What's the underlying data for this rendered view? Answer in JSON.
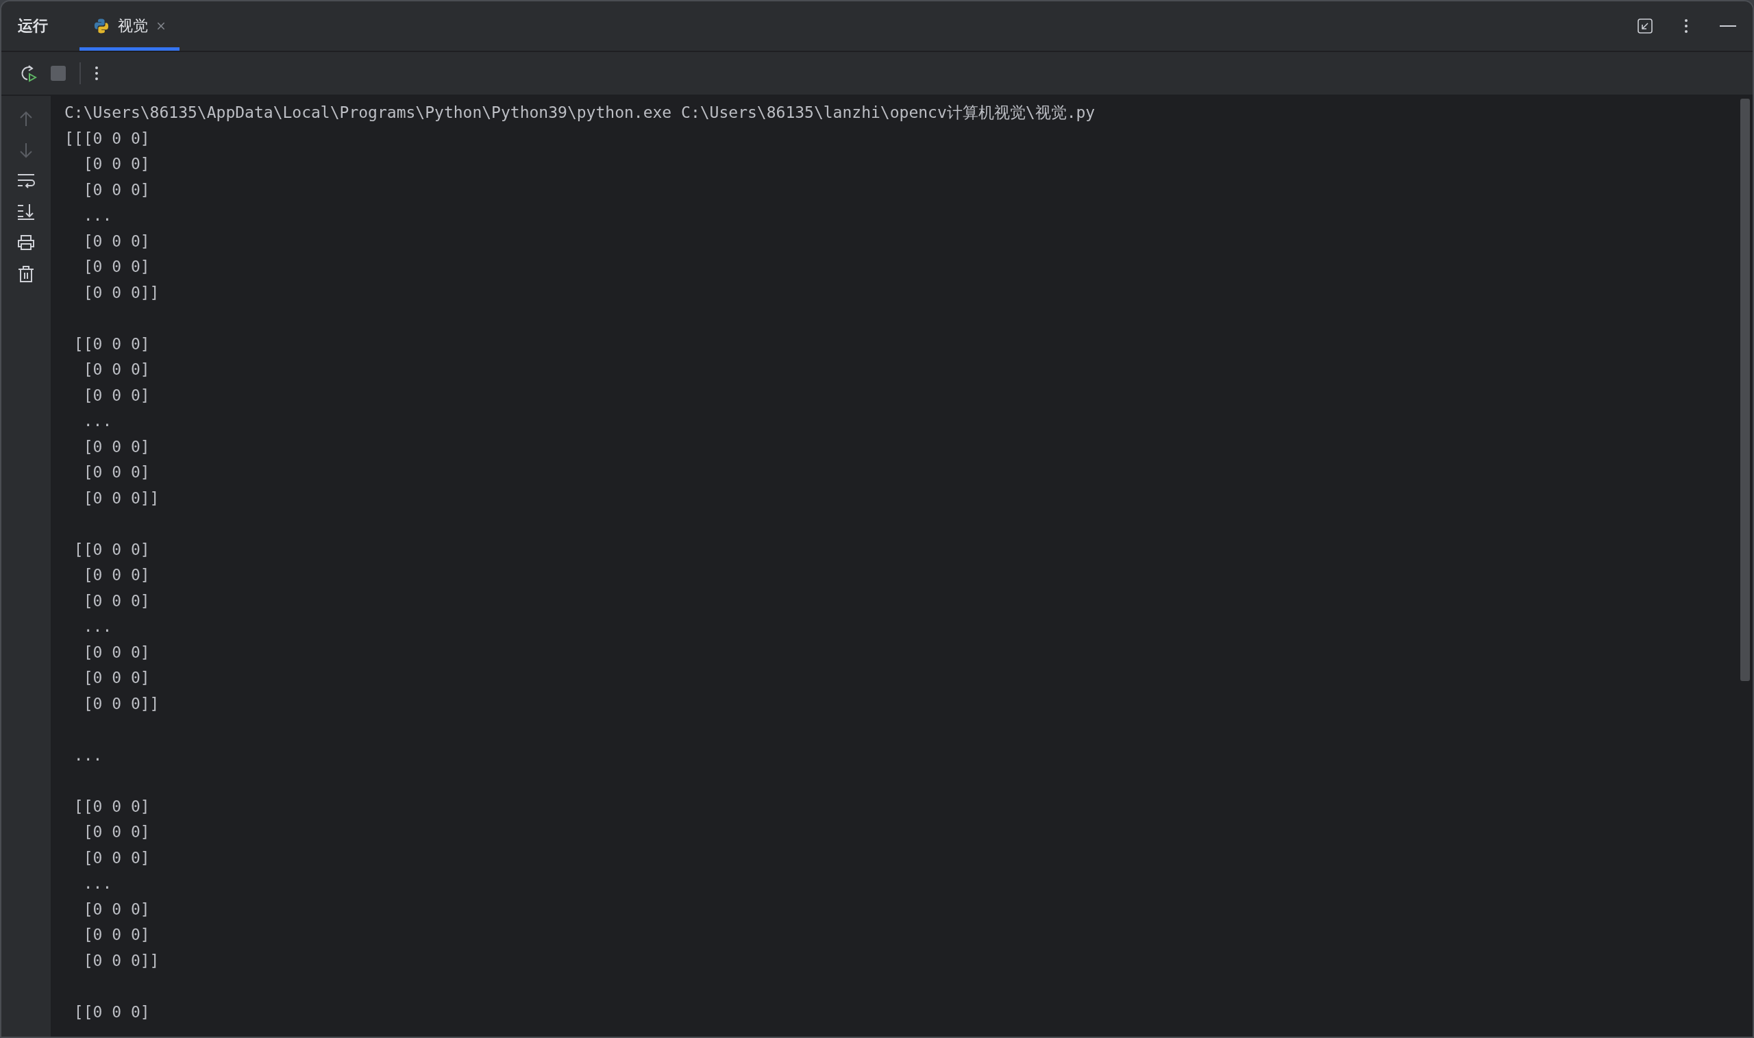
{
  "panel": {
    "title": "运行"
  },
  "tabs": [
    {
      "label": "视觉",
      "selected": true
    }
  ],
  "left_toolbar": [
    {
      "kind": "up",
      "disabled": true
    },
    {
      "kind": "down",
      "disabled": true
    },
    {
      "kind": "wrap",
      "disabled": false
    },
    {
      "kind": "scroll_end",
      "disabled": false
    },
    {
      "kind": "print",
      "disabled": false
    },
    {
      "kind": "delete",
      "disabled": false
    }
  ],
  "output_blocks": [
    [
      "C:\\Users\\86135\\AppData\\Local\\Programs\\Python\\Python39\\python.exe C:\\Users\\86135\\lanzhi\\opencv计算机视觉\\视觉.py",
      "[[[0 0 0]",
      "  [0 0 0]",
      "  [0 0 0]",
      "  ...",
      "  [0 0 0]",
      "  [0 0 0]",
      "  [0 0 0]]"
    ],
    [
      " [[0 0 0]",
      "  [0 0 0]",
      "  [0 0 0]",
      "  ...",
      "  [0 0 0]",
      "  [0 0 0]",
      "  [0 0 0]]"
    ],
    [
      " [[0 0 0]",
      "  [0 0 0]",
      "  [0 0 0]",
      "  ...",
      "  [0 0 0]",
      "  [0 0 0]",
      "  [0 0 0]]"
    ],
    [
      " ..."
    ],
    [
      " [[0 0 0]",
      "  [0 0 0]",
      "  [0 0 0]",
      "  ...",
      "  [0 0 0]",
      "  [0 0 0]",
      "  [0 0 0]]"
    ],
    [
      " [[0 0 0]"
    ]
  ]
}
